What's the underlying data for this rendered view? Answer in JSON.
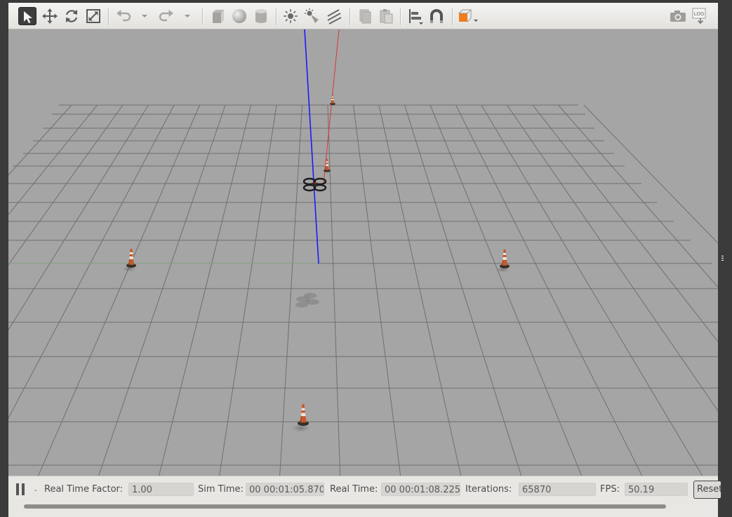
{
  "toolbar": {
    "tools": [
      {
        "icon": "select-arrow-icon"
      },
      {
        "icon": "translate-icon"
      },
      {
        "icon": "rotate-icon"
      },
      {
        "icon": "scale-icon"
      },
      {
        "icon": "undo-icon"
      },
      {
        "icon": "redo-icon"
      },
      {
        "icon": "box-shape-icon"
      },
      {
        "icon": "sphere-shape-icon"
      },
      {
        "icon": "cylinder-shape-icon"
      },
      {
        "icon": "point-light-icon"
      },
      {
        "icon": "spot-light-icon"
      },
      {
        "icon": "directional-light-icon"
      },
      {
        "icon": "copy-icon"
      },
      {
        "icon": "paste-icon"
      },
      {
        "icon": "align-icon"
      },
      {
        "icon": "snap-icon"
      },
      {
        "icon": "view-angle-icon"
      },
      {
        "icon": "screenshot-camera-icon"
      },
      {
        "icon": "log-icon"
      }
    ],
    "log_text": "LOG",
    "accent_color": "#f07c1c"
  },
  "scene": {
    "ground_color": "#a5a5a5",
    "grid_color": "#6f6f6f",
    "z_axis_color": "#1a1aff",
    "x_axis_color": "#d43a3a",
    "y_axis_color": "#7fbf7f",
    "models": [
      "traffic-cone",
      "traffic-cone",
      "traffic-cone",
      "traffic-cone",
      "traffic-cone",
      "quadrotor-drone"
    ]
  },
  "status": {
    "real_time_factor_label": "Real Time Factor:",
    "real_time_factor_value": "1.00",
    "sim_time_label": "Sim Time:",
    "sim_time_value": "00 00:01:05.870",
    "real_time_label": "Real Time:",
    "real_time_value": "00 00:01:08.225",
    "iterations_label": "Iterations:",
    "iterations_value": "65870",
    "fps_label": "FPS:",
    "fps_value": "50.19",
    "reset_label": "Reset",
    "step_label": "-"
  }
}
